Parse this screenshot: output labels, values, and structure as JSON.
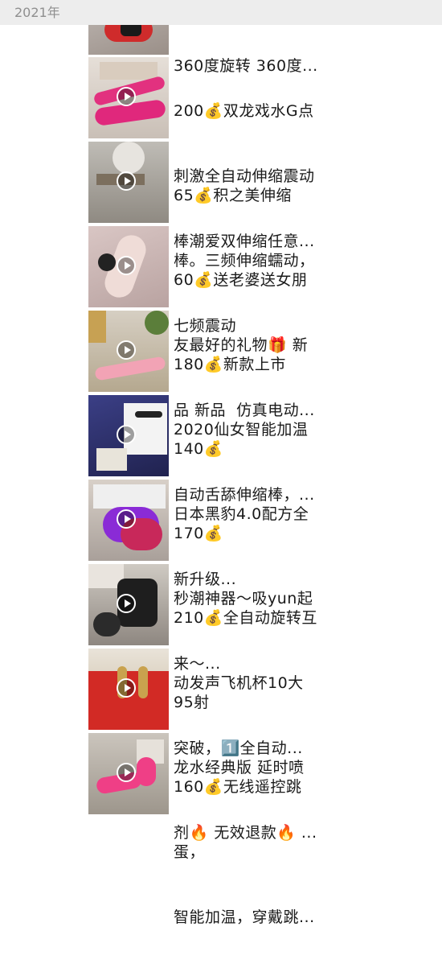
{
  "header": {
    "year": "2021年"
  },
  "posts": [
    {
      "lines": [
        "360度旋转 360度..."
      ]
    },
    {
      "lines": [
        "200💰双龙戏水G点",
        "刺激全自动伸缩震动",
        "棒潮爱双伸缩任意..."
      ]
    },
    {
      "lines": [
        "65💰积之美伸缩",
        "棒。三频伸缩蠕动，",
        "七频震动"
      ]
    },
    {
      "lines": [
        "60💰送老婆送女朋",
        "友最好的礼物🎁 新",
        "品 新品  仿真电动..."
      ]
    },
    {
      "lines": [
        "180💰新款上市",
        "2020仙女智能加温",
        "自动舌舔伸缩棒，..."
      ]
    },
    {
      "lines": [
        "140💰",
        "日本黑豹4.0配方全",
        "新升级..."
      ]
    },
    {
      "lines": [
        "170💰",
        "秒潮神器～吸yun起",
        "来～..."
      ]
    },
    {
      "lines": [
        "210💰全自动旋转互",
        "动发声飞机杯10大",
        "突破，1️⃣全自动..."
      ]
    },
    {
      "lines": [
        "95射",
        "龙水经典版 延时喷",
        "剂🔥 无效退款🔥 ..."
      ]
    },
    {
      "lines": [
        "160💰无线遥控跳",
        "蛋，",
        "智能加温，穿戴跳..."
      ]
    }
  ]
}
